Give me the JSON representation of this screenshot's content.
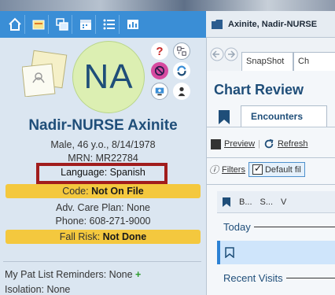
{
  "window": {
    "patient_title": "Axinite, Nadir-NURSE"
  },
  "toolbar": {
    "buttons": [
      {
        "icon": "home-icon"
      },
      {
        "icon": "inbox-icon"
      },
      {
        "icon": "windows-icon"
      },
      {
        "icon": "calendar-icon"
      },
      {
        "icon": "list-icon"
      },
      {
        "icon": "chart-icon"
      }
    ]
  },
  "patient": {
    "initials": "NA",
    "name": "Nadir-NURSE Axinite",
    "demographics": "Male, 46 y.o., 8/14/1978",
    "mrn": "MRN: MR22784",
    "language": "Language: Spanish",
    "code_label": "Code: ",
    "code_value": "Not On File",
    "care_plan": "Adv. Care Plan: None",
    "phone": "Phone: 608-271-9000",
    "fall_label": "Fall Risk: ",
    "fall_value": "Not Done",
    "reminders": "My Pat List Reminders: None",
    "reminders_add": "+",
    "isolation": "Isolation: None"
  },
  "status_icons": {
    "help": "?",
    "colors": {
      "highlight": "#a11d1d",
      "banner": "#f4c83e",
      "accent": "#1f4e79",
      "toolbar": "#3a8ed6"
    }
  },
  "main": {
    "tab_snapshot": "SnapShot",
    "tab_chart": "Ch",
    "title": "Chart Review",
    "encounters_tab": "Encounters",
    "preview": "Preview",
    "refresh": "Refresh",
    "filters": "Filters",
    "default_filter": "Default fil",
    "columns": [
      "B...",
      "S...",
      "V"
    ],
    "group_today": "Today",
    "group_recent": "Recent Visits"
  }
}
